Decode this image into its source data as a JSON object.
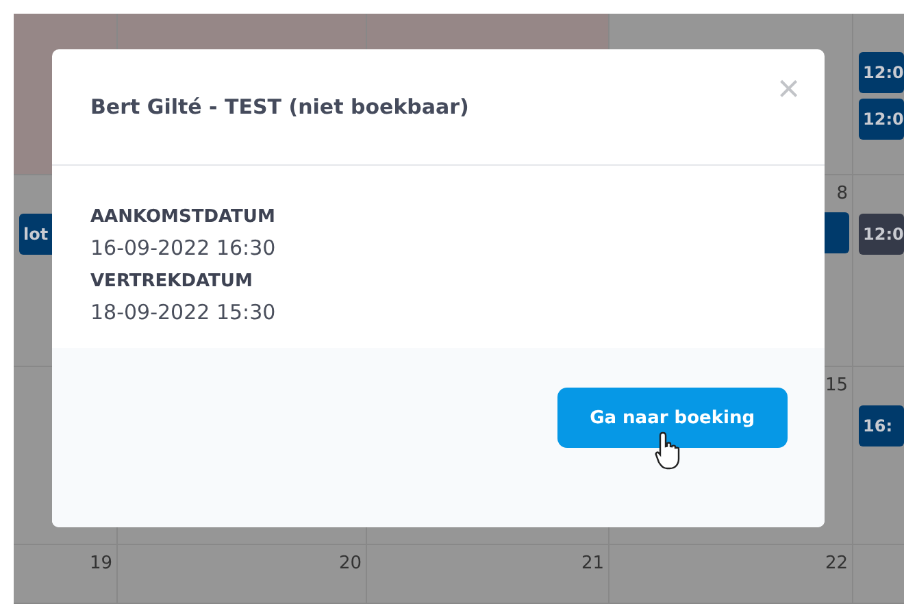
{
  "calendar": {
    "weeks": [
      {
        "cells": [
          {
            "highlighted": true
          },
          {
            "highlighted": true
          },
          {
            "highlighted": true
          },
          {
            "highlighted": false
          },
          {
            "highlighted": false,
            "events": [
              {
                "label": "12:0",
                "color": "#003a6b"
              },
              {
                "label": "12:0",
                "color": "#003a6b"
              }
            ]
          }
        ]
      },
      {
        "cells": [
          {
            "highlighted": false,
            "events": [
              {
                "label": "lot",
                "color": "#003a6b"
              }
            ]
          },
          {},
          {},
          {
            "highlighted": false,
            "day": "8",
            "events": [
              {
                "color": "#003a6b"
              }
            ]
          },
          {
            "highlighted": false,
            "events": [
              {
                "label": "12:0",
                "color": "#353a49"
              }
            ]
          }
        ]
      },
      {
        "cells": [
          {
            "highlighted": false
          },
          {
            "highlighted": false
          },
          {
            "highlighted": false
          },
          {
            "highlighted": false,
            "day": "15"
          },
          {
            "highlighted": false,
            "events": [
              {
                "label": "16:",
                "color": "#003a6b"
              }
            ]
          }
        ]
      },
      {
        "cells": [
          {
            "highlighted": false,
            "day": "19"
          },
          {
            "highlighted": false,
            "day": "20"
          },
          {
            "highlighted": false,
            "day": "21"
          },
          {
            "highlighted": false,
            "day": "22"
          },
          {
            "highlighted": false
          }
        ]
      }
    ]
  },
  "modal": {
    "title": "Bert Gilté - TEST (niet boekbaar)",
    "close": "×",
    "fields": [
      {
        "label": "AANKOMSTDATUM",
        "value": "16-09-2022 16:30"
      },
      {
        "label": "VERTREKDATUM",
        "value": "18-09-2022 15:30"
      }
    ],
    "button": "Ga naar boeking"
  }
}
